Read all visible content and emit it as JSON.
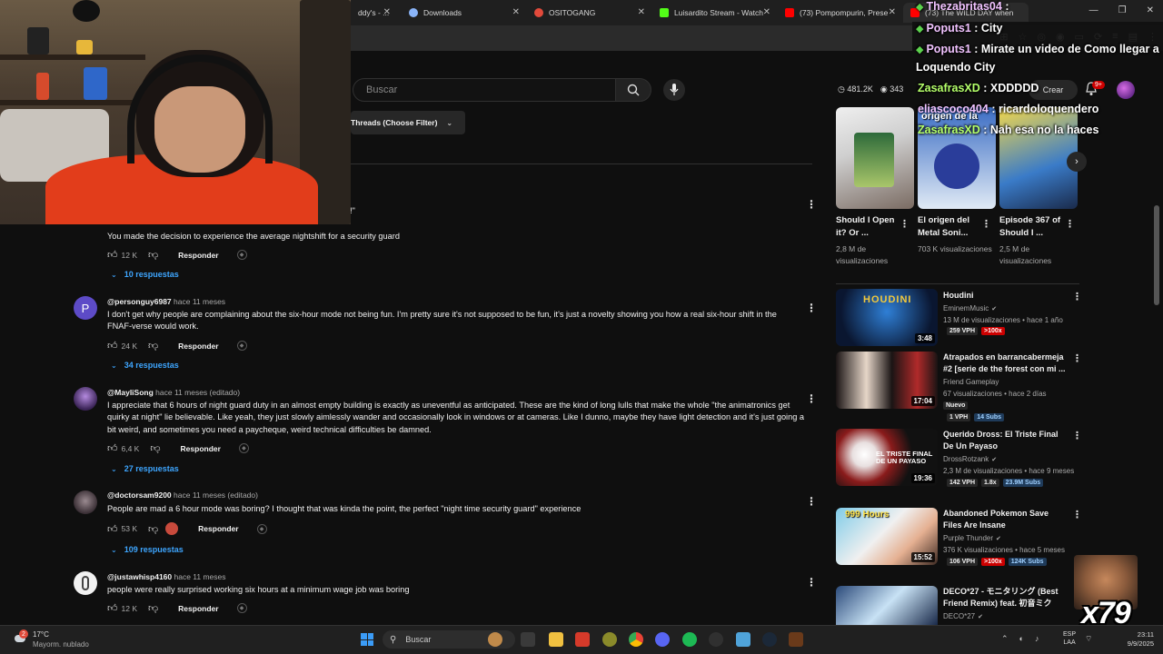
{
  "browser": {
    "tabs": [
      {
        "title": "ddy's - ...",
        "color": "#3a6ee8"
      },
      {
        "title": "Downloads",
        "color": "#8ab4f8"
      },
      {
        "title": "OSITOGANG",
        "color": "#e24a3b"
      },
      {
        "title": "Luisardito Stream - Watch",
        "color": "#53fc18"
      },
      {
        "title": "(73) Pompompurin, Prese",
        "color": "#ff0000"
      },
      {
        "title": "(73) The WILD DAY when",
        "color": "#ff0000"
      }
    ]
  },
  "header": {
    "search_placeholder": "Buscar",
    "stats": {
      "viewers": "481.2K",
      "likes": "343"
    },
    "create_label": "Crear",
    "notifications": "9+"
  },
  "filter": {
    "label": "Threads (Choose Filter)"
  },
  "comments": [
    {
      "partial": "?!\"",
      "body": "You made the decision to experience the average nightshift for a security guard",
      "likes": "12 K",
      "reply_label": "Responder",
      "replies": "10 respuestas"
    },
    {
      "handle": "@personguy6987",
      "time": "hace 11 meses",
      "avatar_letter": "P",
      "body": "I don't get why people are complaining about the six-hour mode not being fun. I'm pretty sure it's not supposed to be fun, it's just a novelty showing you how a real six-hour shift in the FNAF-verse would work.",
      "likes": "24 K",
      "reply_label": "Responder",
      "replies": "34 respuestas"
    },
    {
      "handle": "@MayliSong",
      "time": "hace 11 meses (editado)",
      "body": "I appreciate that 6 hours of night guard duty in an almost empty building is exactly as uneventful as  anticipated. These are the kind of long lulls that make the whole \"the animatronics get quirky at night\" lie believable. Like yeah, they just slowly aimlessly wander and occasionally look in windows or at cameras. Like I dunno, maybe they have light detection and it's just going a bit weird, and sometimes you need a paycheque, weird technical difficulties be damned.",
      "likes": "6,4 K",
      "reply_label": "Responder",
      "replies": "27 respuestas"
    },
    {
      "handle": "@doctorsam9200",
      "time": "hace 11 meses (editado)",
      "body": "People are mad a 6 hour mode was boring? I thought that was kinda the point, the perfect \"night time security guard\" experience",
      "likes": "53 K",
      "reply_label": "Responder",
      "replies": "109 respuestas"
    },
    {
      "handle": "@justawhisp4160",
      "time": "hace 11 meses",
      "body": "people were really surprised working six hours at a minimum wage job was boring",
      "likes": "12 K",
      "reply_label": "Responder"
    }
  ],
  "shorts": [
    {
      "title": "Should I Open it? Or ...",
      "views": "2,8 M de visualizaciones"
    },
    {
      "title": "El origen del Metal Soni...",
      "views": "703 K visualizaciones"
    },
    {
      "title": "Episode 367 of Should I ...",
      "views": "2,5 M de visualizaciones"
    }
  ],
  "recommended": [
    {
      "title": "Houdini",
      "channel": "EminemMusic",
      "meta": "13 M de visualizaciones • hace 1 año",
      "duration": "3:48",
      "vph": "259 VPH",
      "ratio": ">100x",
      "subs": ""
    },
    {
      "title": "Atrapados en barrancabermeja #2 [serie de the forest con mi ...",
      "channel": "Friend Gameplay",
      "meta": "67 visualizaciones • hace 2 días",
      "duration": "17:04",
      "new": "Nuevo",
      "vph": "1 VPH",
      "ratio": "",
      "subs": "14 Subs"
    },
    {
      "title": "Querido Dross: El Triste Final De Un Payaso",
      "channel": "DrossRotzank",
      "meta": "2,3 M de visualizaciones • hace 9 meses",
      "duration": "19:36",
      "vph": "142 VPH",
      "ratio": "1.8x",
      "subs": "23.9M Subs"
    },
    {
      "title": "Abandoned Pokemon Save Files Are Insane",
      "channel": "Purple Thunder",
      "meta": "376 K visualizaciones • hace 5 meses",
      "duration": "15:52",
      "vph": "106 VPH",
      "ratio": ">100x",
      "subs": "124K Subs"
    },
    {
      "title": "DECO*27 - モニタリング (Best Friend Remix) feat. 初音ミク",
      "channel": "DECO*27",
      "meta": "",
      "duration": "",
      "vph": "",
      "ratio": "",
      "subs": ""
    }
  ],
  "thumb_texts": {
    "houdini": "HOUDINI",
    "payaso": "EL TRISTE FINAL DE UN PAYASO",
    "pokemon": "999 Hours",
    "origen": "origen de la"
  },
  "chat": [
    {
      "user": "Thezabritas04",
      "msg": " :"
    },
    {
      "user": "Poputs1",
      "msg": " : City"
    },
    {
      "user": "Poputs1",
      "msg": " : Mirate un video de Como llegar a"
    },
    {
      "user": "",
      "msg": "Loquendo City"
    },
    {
      "user": "ZasafrasXD",
      "msg": " : XDDDDD"
    },
    {
      "user": "eliascoco404",
      "msg": " : ricardoloquendero"
    },
    {
      "user": "ZasafrasXD",
      "msg": " : Nah esa no la haces"
    }
  ],
  "counter": "x79",
  "taskbar": {
    "weather_temp": "17°C",
    "weather_desc": "Mayorm. nublado",
    "weather_badge": "2",
    "search_label": "Buscar",
    "lang_top": "ESP",
    "lang_bottom": "LAA",
    "time": "23:11",
    "date": "9/9/2025"
  }
}
